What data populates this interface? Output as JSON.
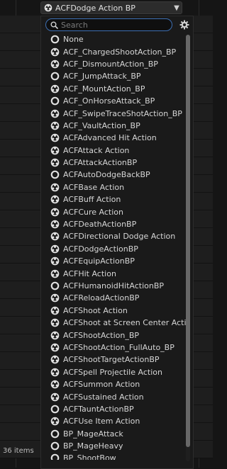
{
  "combo": {
    "selected": "ACFDodge Action BP",
    "icon": "actor-class-icon",
    "dropdown_icon": "chevron-down-icon"
  },
  "search": {
    "placeholder": "Search",
    "value": ""
  },
  "settings_icon": "gear-icon",
  "items": [
    {
      "label": "None",
      "icon": "none-icon"
    },
    {
      "label": "ACF_ChargedShootAction_BP",
      "icon": "actor-class-icon"
    },
    {
      "label": "ACF_DismountAction_BP",
      "icon": "actor-class-icon"
    },
    {
      "label": "ACF_JumpAttack_BP",
      "icon": "object-class-icon"
    },
    {
      "label": "ACF_MountAction_BP",
      "icon": "actor-class-icon"
    },
    {
      "label": "ACF_OnHorseAttack_BP",
      "icon": "object-class-icon"
    },
    {
      "label": "ACF_SwipeTraceShotAction_BP",
      "icon": "actor-class-icon"
    },
    {
      "label": "ACF_VaultAction_BP",
      "icon": "actor-class-icon"
    },
    {
      "label": "ACFAdvanced Hit Action",
      "icon": "actor-class-icon"
    },
    {
      "label": "ACFAttack Action",
      "icon": "actor-class-icon"
    },
    {
      "label": "ACFAttackActionBP",
      "icon": "actor-class-icon"
    },
    {
      "label": "ACFAutoDodgeBackBP",
      "icon": "object-class-icon"
    },
    {
      "label": "ACFBase Action",
      "icon": "actor-class-icon"
    },
    {
      "label": "ACFBuff Action",
      "icon": "actor-class-icon"
    },
    {
      "label": "ACFCure Action",
      "icon": "actor-class-icon"
    },
    {
      "label": "ACFDeathActionBP",
      "icon": "actor-class-icon"
    },
    {
      "label": "ACFDirectional Dodge Action",
      "icon": "actor-class-icon"
    },
    {
      "label": "ACFDodgeActionBP",
      "icon": "actor-class-icon"
    },
    {
      "label": "ACFEquipActionBP",
      "icon": "actor-class-icon"
    },
    {
      "label": "ACFHit Action",
      "icon": "actor-class-icon"
    },
    {
      "label": "ACFHumanoidHitActionBP",
      "icon": "object-class-icon"
    },
    {
      "label": "ACFReloadActionBP",
      "icon": "actor-class-icon"
    },
    {
      "label": "ACFShoot Action",
      "icon": "actor-class-icon"
    },
    {
      "label": "ACFShoot at Screen Center Action",
      "icon": "actor-class-icon"
    },
    {
      "label": "ACFShootAction_BP",
      "icon": "actor-class-icon"
    },
    {
      "label": "ACFShootAction_FullAuto_BP",
      "icon": "actor-class-icon"
    },
    {
      "label": "ACFShootTargetActionBP",
      "icon": "actor-class-icon"
    },
    {
      "label": "ACFSpell Projectile Action",
      "icon": "actor-class-icon"
    },
    {
      "label": "ACFSummon Action",
      "icon": "actor-class-icon"
    },
    {
      "label": "ACFSustained Action",
      "icon": "actor-class-icon"
    },
    {
      "label": "ACFTauntActionBP",
      "icon": "object-class-icon"
    },
    {
      "label": "ACFUse Item Action",
      "icon": "actor-class-icon"
    },
    {
      "label": "BP_MageAttack",
      "icon": "object-class-icon"
    },
    {
      "label": "BP_MageHeavy",
      "icon": "object-class-icon"
    },
    {
      "label": "BP_ShootBow",
      "icon": "object-class-icon"
    }
  ],
  "footer": {
    "count_text": "36 items"
  },
  "colors": {
    "accent": "#3d6fb3",
    "background": "#1a1a1a",
    "text": "#d6d6d6"
  }
}
